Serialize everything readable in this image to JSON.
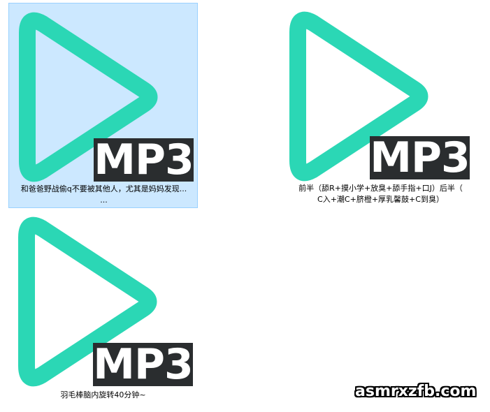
{
  "files": [
    {
      "badge": "MP3",
      "caption_line1": "和爸爸野战偷q不要被其他人，尤其是妈妈发现...",
      "caption_line2": "...",
      "selected": true
    },
    {
      "badge": "MP3",
      "caption_line1": "前半（舔R+摸小学+放臭+舔手指+口J）后半（",
      "caption_line2": "C入+潮C+脐橙+厚乳馨鼓+C到臭）",
      "selected": false
    },
    {
      "badge": "MP3",
      "caption_line1": "羽毛棒脑内旋转40分钟~",
      "caption_line2": "",
      "selected": false
    }
  ],
  "icon": {
    "name": "mp3-play-icon",
    "color": "#2bd7b5",
    "badge_bg": "#2a2d2f"
  },
  "watermark": "asmrxzfb.com"
}
